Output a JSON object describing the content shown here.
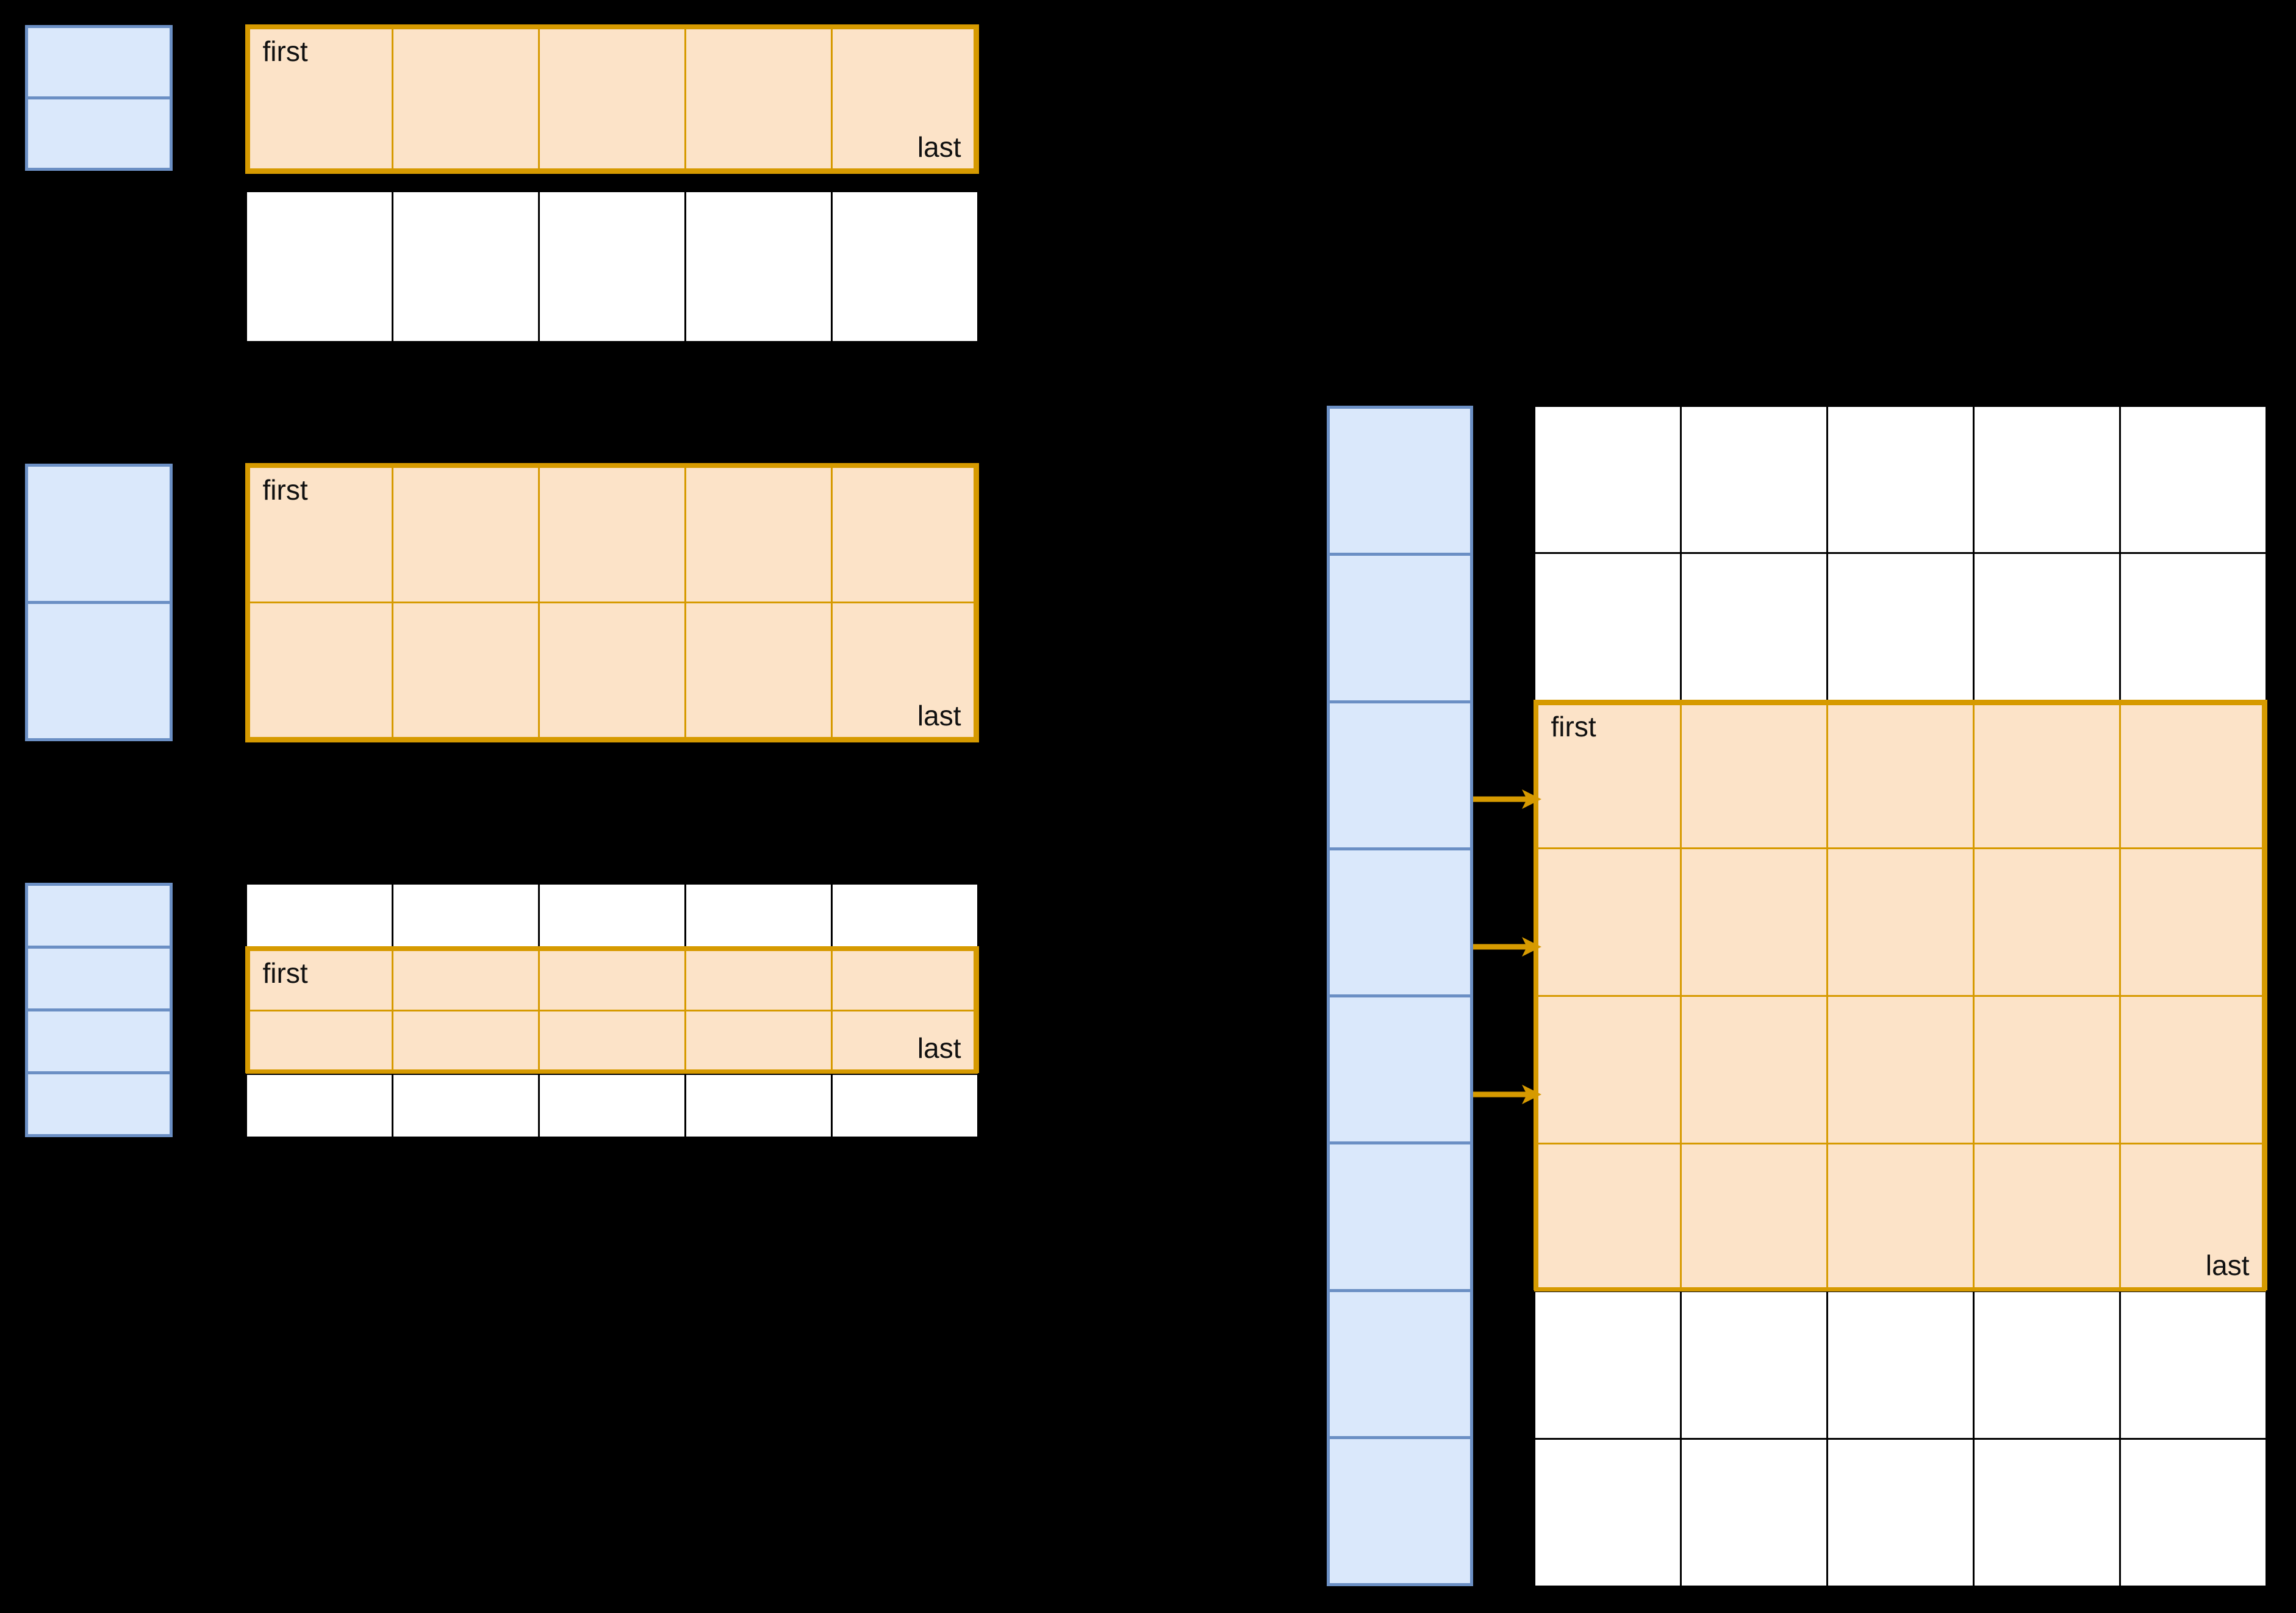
{
  "colors": {
    "background": "#000000",
    "blue_fill": "#DAE8FB",
    "blue_stroke": "#6B8FC4",
    "orange_fill": "#FCE3C8",
    "orange_stroke": "#D69A00",
    "plain_fill": "#FFFFFF",
    "plain_stroke": "#000000",
    "label_text": "#111111"
  },
  "labels": {
    "first": "first",
    "last": "last"
  },
  "panels": [
    {
      "id": "panel-1",
      "name": "one-row-selection",
      "index_column": {
        "cells": 2,
        "highlighted": []
      },
      "grid": {
        "rows": 2,
        "cols": 5,
        "highlighted_rows": [
          0
        ]
      },
      "first_cell": {
        "row": 0,
        "col": 0
      },
      "last_cell": {
        "row": 0,
        "col": 4
      },
      "arrows": []
    },
    {
      "id": "panel-2",
      "name": "two-row-selection",
      "index_column": {
        "cells": 2,
        "highlighted": []
      },
      "grid": {
        "rows": 2,
        "cols": 5,
        "highlighted_rows": [
          0,
          1
        ]
      },
      "first_cell": {
        "row": 0,
        "col": 0
      },
      "last_cell": {
        "row": 1,
        "col": 4
      },
      "arrows": []
    },
    {
      "id": "panel-3",
      "name": "middle-two-row-selection",
      "index_column": {
        "cells": 4,
        "highlighted": []
      },
      "grid": {
        "rows": 4,
        "cols": 5,
        "highlighted_rows": [
          1,
          2
        ]
      },
      "first_cell": {
        "row": 1,
        "col": 0
      },
      "last_cell": {
        "row": 2,
        "col": 4
      },
      "arrows": []
    },
    {
      "id": "panel-4",
      "name": "indexed-four-row-selection",
      "index_column": {
        "cells": 8,
        "highlighted": []
      },
      "grid": {
        "rows": 8,
        "cols": 5,
        "highlighted_rows": [
          2,
          3,
          4,
          5
        ]
      },
      "first_cell": {
        "row": 2,
        "col": 0
      },
      "last_cell": {
        "row": 5,
        "col": 4
      },
      "arrows": [
        {
          "from_index_cell": 2,
          "to_grid_row": 2
        },
        {
          "from_index_cell": 3,
          "to_grid_row": 3
        },
        {
          "from_index_cell": 4,
          "to_grid_row": 4
        }
      ]
    }
  ]
}
